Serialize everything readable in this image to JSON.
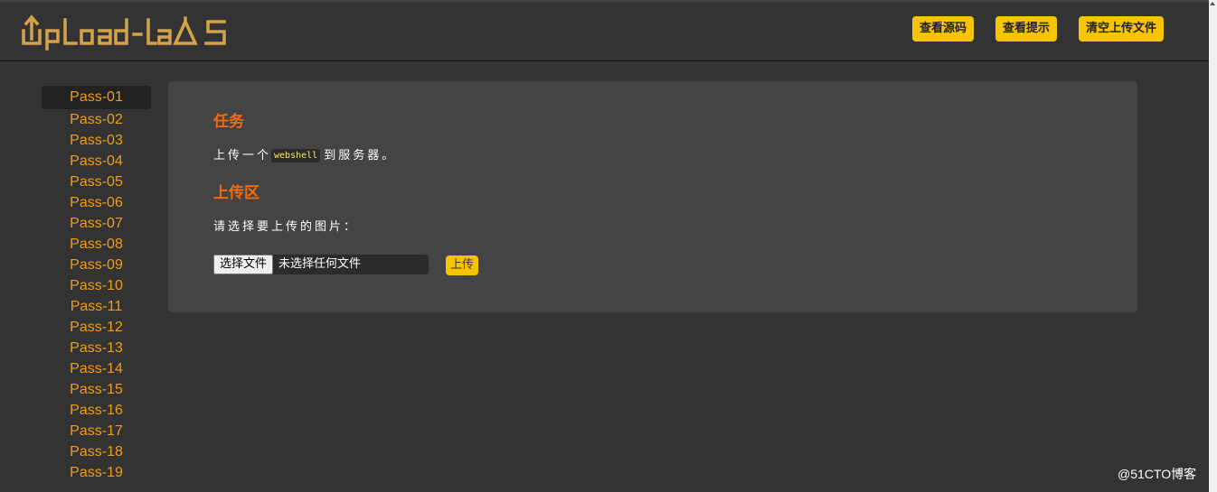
{
  "header": {
    "logo_text": "UpLoad-LabS",
    "buttons": [
      "查看源码",
      "查看提示",
      "清空上传文件"
    ]
  },
  "sidebar": {
    "items": [
      "Pass-01",
      "Pass-02",
      "Pass-03",
      "Pass-04",
      "Pass-05",
      "Pass-06",
      "Pass-07",
      "Pass-08",
      "Pass-09",
      "Pass-10",
      "Pass-11",
      "Pass-12",
      "Pass-13",
      "Pass-14",
      "Pass-15",
      "Pass-16",
      "Pass-17",
      "Pass-18",
      "Pass-19"
    ],
    "active_index": 0
  },
  "main": {
    "task_title": "任务",
    "task_prefix": "上传一个",
    "task_code": "webshell",
    "task_suffix": "到服务器。",
    "upload_title": "上传区",
    "upload_prompt": "请选择要上传的图片：",
    "file_button_label": "选择文件",
    "file_status": "未选择任何文件",
    "upload_button_label": "上传"
  },
  "watermark": "@51CTO博客",
  "colors": {
    "background": "#333333",
    "panel": "#444444",
    "accent_yellow": "#f7c500",
    "heading_orange": "#f26a0e",
    "nav_orange": "#f39c12"
  }
}
